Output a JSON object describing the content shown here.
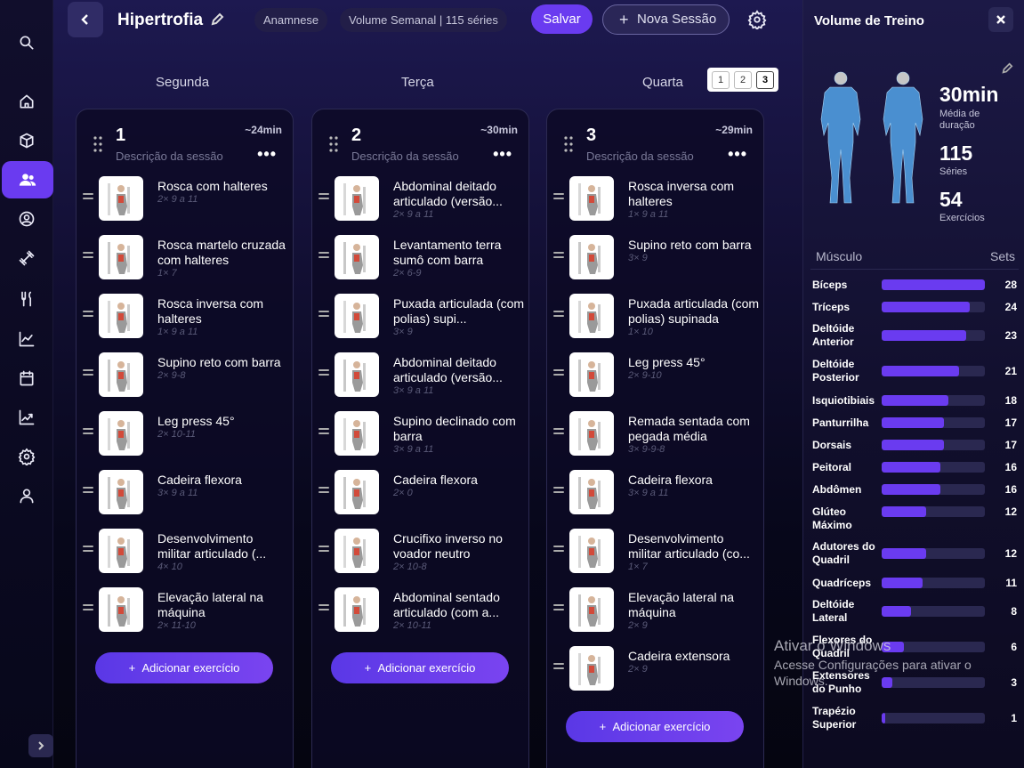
{
  "sidebar": {
    "items": [
      {
        "icon": "search-icon"
      },
      {
        "icon": "home-icon"
      },
      {
        "icon": "box-icon"
      },
      {
        "icon": "users-icon",
        "active": true
      },
      {
        "icon": "user-circle-icon"
      },
      {
        "icon": "dumbbell-icon"
      },
      {
        "icon": "fork-knife-icon"
      },
      {
        "icon": "line-chart-icon"
      },
      {
        "icon": "calendar-icon"
      },
      {
        "icon": "trend-chart-icon"
      },
      {
        "icon": "settings-icon"
      },
      {
        "icon": "profile-icon"
      }
    ]
  },
  "header": {
    "title": "Hipertrofia",
    "chips": [
      "Anamnese",
      "Volume Semanal | 115 séries"
    ],
    "save_label": "Salvar",
    "new_session_label": "Nova Sessão",
    "new_session_icon": "+"
  },
  "days": [
    "Segunda",
    "Terça",
    "Quarta"
  ],
  "pager": {
    "pages": [
      "1",
      "2",
      "3"
    ],
    "active": "3"
  },
  "accent": "#6a3bf0",
  "sessions": [
    {
      "num": "1",
      "duration": "~24min",
      "desc": "Descrição da sessão",
      "more": "•••",
      "add_label": "Adicionar exercício",
      "exercises": [
        {
          "name": "Rosca com halteres",
          "reps": "2× 9 a 11"
        },
        {
          "name": "Rosca martelo cruzada com halteres",
          "reps": "1× 7"
        },
        {
          "name": "Rosca inversa com halteres",
          "reps": "1× 9 a 11"
        },
        {
          "name": "Supino reto com barra",
          "reps": "2× 9-8"
        },
        {
          "name": "Leg press 45°",
          "reps": "2× 10-11"
        },
        {
          "name": "Cadeira flexora",
          "reps": "3× 9 a 11"
        },
        {
          "name": "Desenvolvimento militar articulado (...",
          "reps": "4× 10"
        },
        {
          "name": "Elevação lateral na máquina",
          "reps": "2× 11-10"
        }
      ]
    },
    {
      "num": "2",
      "duration": "~30min",
      "desc": "Descrição da sessão",
      "more": "•••",
      "add_label": "Adicionar exercício",
      "exercises": [
        {
          "name": "Abdominal deitado articulado (versão...",
          "reps": "2× 9 a 11"
        },
        {
          "name": "Levantamento terra sumô com barra",
          "reps": "2× 6-9"
        },
        {
          "name": "Puxada articulada (com polias) supi...",
          "reps": "3× 9"
        },
        {
          "name": "Abdominal deitado articulado (versão...",
          "reps": "3× 9 a 11"
        },
        {
          "name": "Supino declinado com barra",
          "reps": "3× 9 a 11"
        },
        {
          "name": "Cadeira flexora",
          "reps": "2× 0"
        },
        {
          "name": "Crucifixo inverso no voador neutro",
          "reps": "2× 10-8"
        },
        {
          "name": "Abdominal sentado articulado (com a...",
          "reps": "2× 10-11"
        }
      ]
    },
    {
      "num": "3",
      "duration": "~29min",
      "desc": "Descrição da sessão",
      "more": "•••",
      "add_label": "Adicionar exercício",
      "exercises": [
        {
          "name": "Rosca inversa com halteres",
          "reps": "1× 9 a 11"
        },
        {
          "name": "Supino reto com barra",
          "reps": "3× 9"
        },
        {
          "name": "Puxada articulada (com polias) supinada",
          "reps": "1× 10"
        },
        {
          "name": "Leg press 45°",
          "reps": "2× 9-10"
        },
        {
          "name": "Remada sentada com pegada média",
          "reps": "3× 9-9-8"
        },
        {
          "name": "Cadeira flexora",
          "reps": "3× 9 a 11"
        },
        {
          "name": "Desenvolvimento militar articulado (co...",
          "reps": "1× 7"
        },
        {
          "name": "Elevação lateral na máquina",
          "reps": "2× 9"
        },
        {
          "name": "Cadeira extensora",
          "reps": "2× 9"
        }
      ]
    }
  ],
  "panel": {
    "title": "Volume de Treino",
    "stats": [
      {
        "value": "30min",
        "label": "Média de duração"
      },
      {
        "value": "115",
        "label": "Séries"
      },
      {
        "value": "54",
        "label": "Exercícios"
      }
    ],
    "col_muscle": "Músculo",
    "col_sets": "Sets",
    "max_sets": 28,
    "muscles": [
      {
        "name": "Bíceps",
        "sets": 28
      },
      {
        "name": "Tríceps",
        "sets": 24
      },
      {
        "name": "Deltóide Anterior",
        "sets": 23
      },
      {
        "name": "Deltóide Posterior",
        "sets": 21
      },
      {
        "name": "Isquiotibiais",
        "sets": 18
      },
      {
        "name": "Panturrilha",
        "sets": 17
      },
      {
        "name": "Dorsais",
        "sets": 17
      },
      {
        "name": "Peitoral",
        "sets": 16
      },
      {
        "name": "Abdômen",
        "sets": 16
      },
      {
        "name": "Glúteo Máximo",
        "sets": 12
      },
      {
        "name": "Adutores do Quadril",
        "sets": 12
      },
      {
        "name": "Quadríceps",
        "sets": 11
      },
      {
        "name": "Deltóide Lateral",
        "sets": 8
      },
      {
        "name": "Flexores do Quadril",
        "sets": 6
      },
      {
        "name": "Extensores do Punho",
        "sets": 3
      },
      {
        "name": "Trapézio Superior",
        "sets": 1
      }
    ]
  },
  "watermark": {
    "line1": "Ativar o Windows",
    "line2": "Acesse Configurações para ativar o Windows."
  }
}
